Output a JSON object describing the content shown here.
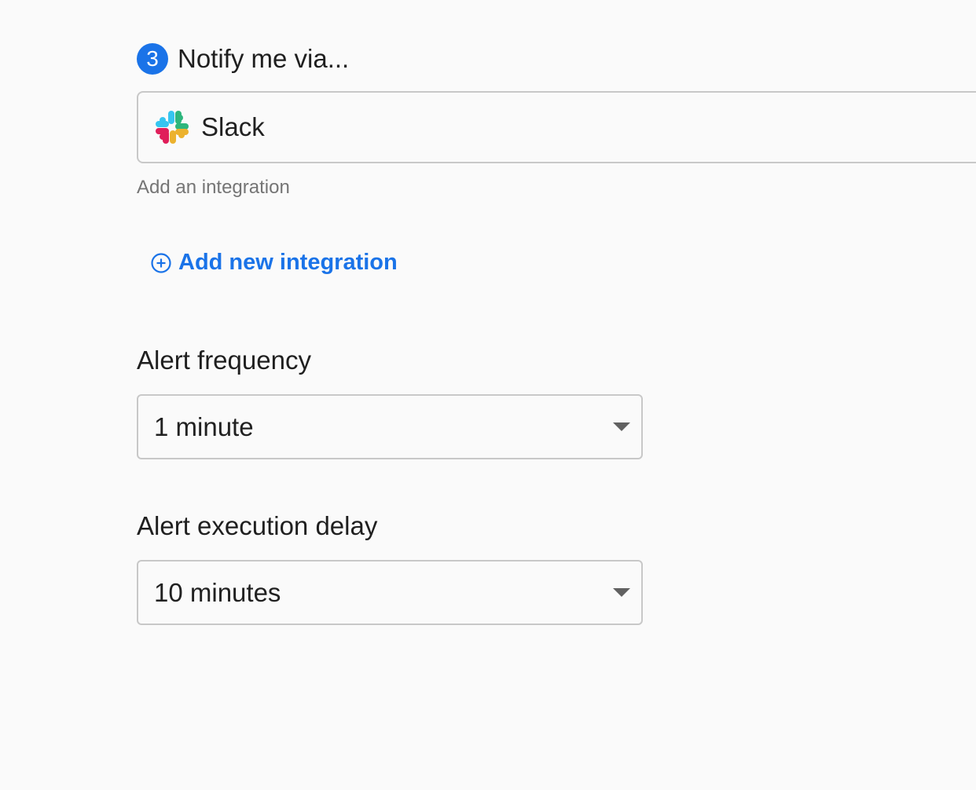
{
  "notify_section": {
    "step_number": "3",
    "title": "Notify me via...",
    "integration": {
      "name": "Slack",
      "icon": "slack-logo-icon"
    },
    "helper_text": "Add an integration",
    "add_integration_label": "Add new integration",
    "add_icon": "plus-circle-icon"
  },
  "alert_frequency": {
    "label": "Alert frequency",
    "value": "1 minute"
  },
  "alert_delay": {
    "label": "Alert execution delay",
    "value": "10 minutes"
  },
  "colors": {
    "accent": "#1a73e8",
    "background": "#fafafa",
    "border": "#c8c8c8",
    "helper_text": "#757575"
  }
}
